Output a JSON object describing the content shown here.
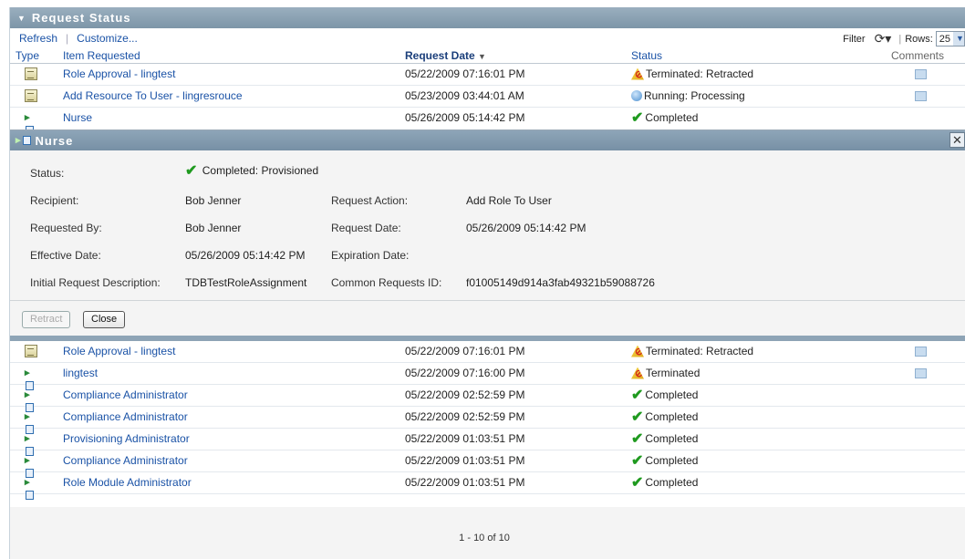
{
  "panel": {
    "title": "Request Status"
  },
  "toolbar": {
    "refresh": "Refresh",
    "customize": "Customize...",
    "filter": "Filter",
    "rows_label": "Rows:",
    "rows_value": "25"
  },
  "columns": {
    "type": "Type",
    "item": "Item Requested",
    "date": "Request Date",
    "status": "Status",
    "comments": "Comments"
  },
  "rows_top": [
    {
      "item": "Role Approval - lingtest",
      "date": "05/22/2009 07:16:01 PM",
      "status": "Terminated: Retracted"
    },
    {
      "item": "Add Resource To User - lingresrouce",
      "date": "05/23/2009 03:44:01 AM",
      "status": "Running: Processing"
    },
    {
      "item": "Nurse",
      "date": "05/26/2009 05:14:42 PM",
      "status": "Completed"
    }
  ],
  "detail": {
    "title": "Nurse",
    "status_label": "Status:",
    "status_value": "Completed: Provisioned",
    "recipient_label": "Recipient:",
    "recipient_value": "Bob Jenner",
    "request_action_label": "Request Action:",
    "request_action_value": "Add Role To User",
    "requested_by_label": "Requested By:",
    "requested_by_value": "Bob Jenner",
    "request_date_label": "Request Date:",
    "request_date_value": "05/26/2009 05:14:42 PM",
    "effective_date_label": "Effective Date:",
    "effective_date_value": "05/26/2009 05:14:42 PM",
    "expiration_date_label": "Expiration Date:",
    "initial_desc_label": "Initial Request Description:",
    "initial_desc_value": "TDBTestRoleAssignment",
    "common_id_label": "Common Requests ID:",
    "common_id_value": "f01005149d914a3fab49321b59088726",
    "retract": "Retract",
    "close": "Close"
  },
  "rows_bottom": [
    {
      "item": "Role Approval - lingtest",
      "date": "05/22/2009 07:16:01 PM",
      "status": "Terminated: Retracted"
    },
    {
      "item": "lingtest",
      "date": "05/22/2009 07:16:00 PM",
      "status": "Terminated"
    },
    {
      "item": "Compliance Administrator",
      "date": "05/22/2009 02:52:59 PM",
      "status": "Completed"
    },
    {
      "item": "Compliance Administrator",
      "date": "05/22/2009 02:52:59 PM",
      "status": "Completed"
    },
    {
      "item": "Provisioning Administrator",
      "date": "05/22/2009 01:03:51 PM",
      "status": "Completed"
    },
    {
      "item": "Compliance Administrator",
      "date": "05/22/2009 01:03:51 PM",
      "status": "Completed"
    },
    {
      "item": "Role Module Administrator",
      "date": "05/22/2009 01:03:51 PM",
      "status": "Completed"
    }
  ],
  "pager": "1 - 10 of 10"
}
